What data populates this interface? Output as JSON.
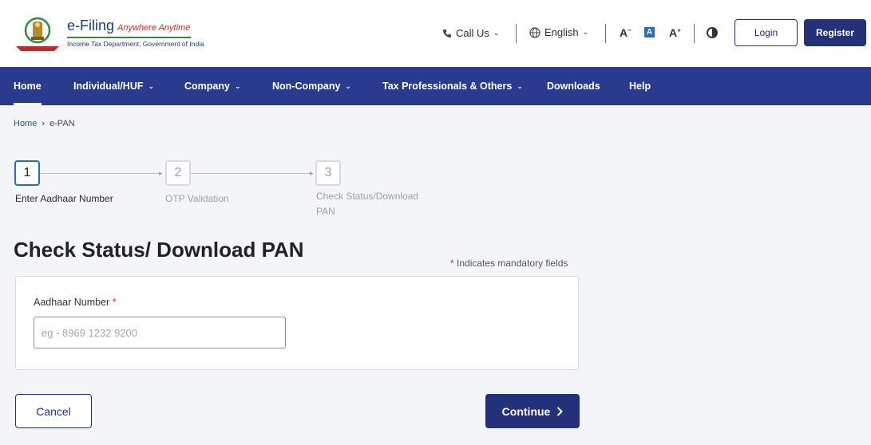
{
  "header": {
    "brand": {
      "title": "e-Filing",
      "tagline": "Anywhere Anytime",
      "subtitle": "Income Tax Department, Government of India"
    },
    "call_us": "Call Us",
    "language": "English",
    "font_decrease": "A",
    "font_default": "A",
    "font_increase": "A",
    "login": "Login",
    "register": "Register"
  },
  "nav": {
    "items": [
      {
        "label": "Home",
        "dropdown": false,
        "active": true
      },
      {
        "label": "Individual/HUF",
        "dropdown": true
      },
      {
        "label": "Company",
        "dropdown": true
      },
      {
        "label": "Non-Company",
        "dropdown": true
      },
      {
        "label": "Tax Professionals & Others",
        "dropdown": true
      },
      {
        "label": "Downloads",
        "dropdown": false
      },
      {
        "label": "Help",
        "dropdown": false
      }
    ]
  },
  "breadcrumb": {
    "home": "Home",
    "separator": "›",
    "current": "e-PAN"
  },
  "stepper": {
    "steps": [
      {
        "number": "1",
        "label": "Enter Aadhaar Number",
        "state": "active"
      },
      {
        "number": "2",
        "label": "OTP Validation",
        "state": "inactive"
      },
      {
        "number": "3",
        "label_line1": "Check Status/Download",
        "label_line2": "PAN",
        "state": "inactive"
      }
    ]
  },
  "main": {
    "title": "Check Status/ Download PAN",
    "mandatory_star": "*",
    "mandatory_note": "Indicates mandatory fields",
    "aadhaar_label": "Aadhaar Number",
    "aadhaar_required": "*",
    "aadhaar_value": "",
    "aadhaar_placeholder": "eg - 8969 1232 9200"
  },
  "actions": {
    "cancel": "Cancel",
    "continue": "Continue"
  },
  "colors": {
    "primary": "#23307a",
    "nav_bg": "#2a3b8f",
    "accent_blue": "#1f6fd1",
    "required": "#d02a2a",
    "page_bg": "#f4f5f8"
  }
}
